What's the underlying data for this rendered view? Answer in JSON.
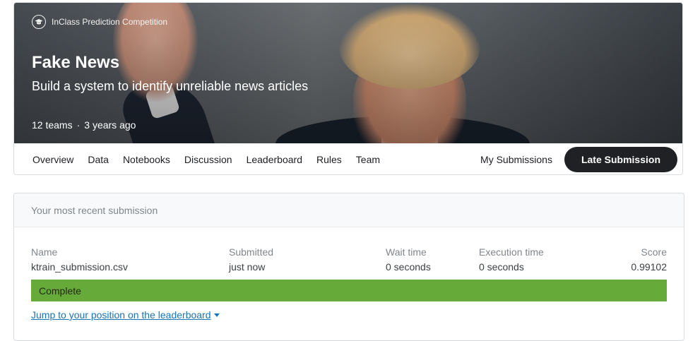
{
  "competition": {
    "badge": "InClass Prediction Competition",
    "title": "Fake News",
    "subtitle": "Build a system to identify unreliable news articles",
    "teams": "12 teams",
    "separator": "·",
    "age": "3 years ago"
  },
  "nav": {
    "tabs": [
      "Overview",
      "Data",
      "Notebooks",
      "Discussion",
      "Leaderboard",
      "Rules",
      "Team"
    ],
    "my_submissions": "My Submissions",
    "late_submission": "Late Submission"
  },
  "submission": {
    "header": "Your most recent submission",
    "columns": {
      "name": {
        "label": "Name",
        "value": "ktrain_submission.csv"
      },
      "submitted": {
        "label": "Submitted",
        "value": "just now"
      },
      "wait": {
        "label": "Wait time",
        "value": "0 seconds"
      },
      "execution": {
        "label": "Execution time",
        "value": "0 seconds"
      },
      "score": {
        "label": "Score",
        "value": "0.99102"
      }
    },
    "status": "Complete",
    "jump_link": "Jump to your position on the leaderboard"
  },
  "colors": {
    "complete": "#66ab3a",
    "link": "#1a73b5",
    "button": "#202124"
  }
}
